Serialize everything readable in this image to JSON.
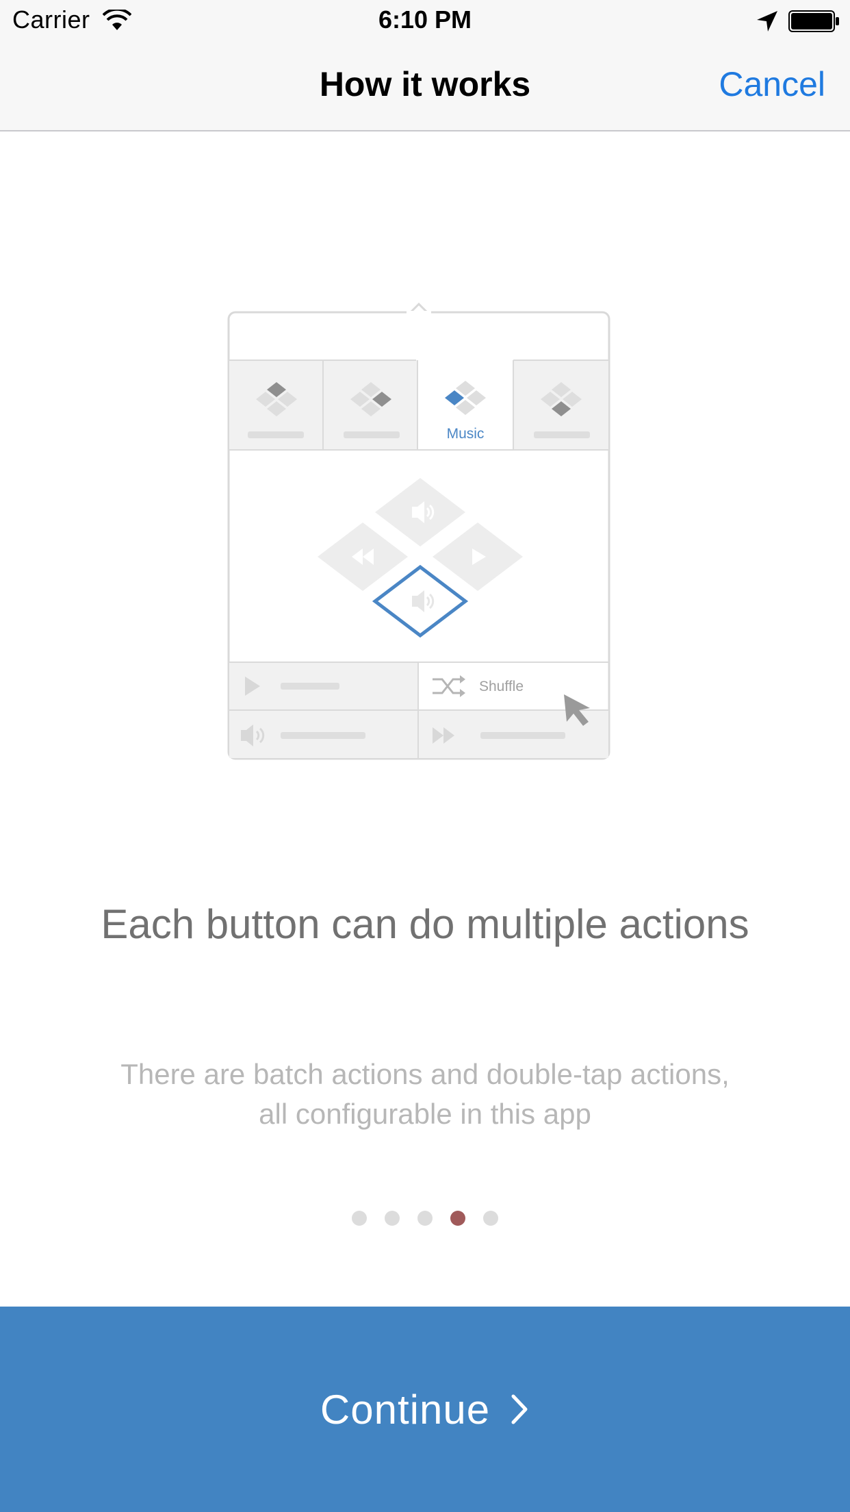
{
  "status_bar": {
    "carrier": "Carrier",
    "time": "6:10 PM"
  },
  "nav": {
    "title": "How it works",
    "cancel_label": "Cancel"
  },
  "illustration": {
    "tab_label": "Music",
    "shuffle_label": "Shuffle"
  },
  "content": {
    "headline": "Each button can do multiple actions",
    "subtext": "There are batch actions and double-tap actions, all configurable in this app"
  },
  "pager": {
    "total": 5,
    "active_index": 3
  },
  "continue": {
    "label": "Continue"
  },
  "colors": {
    "accent": "#1f7ae0",
    "button": "#4284c2",
    "active_dot": "#a05a5a",
    "diamond_blue": "#4a86c5"
  }
}
